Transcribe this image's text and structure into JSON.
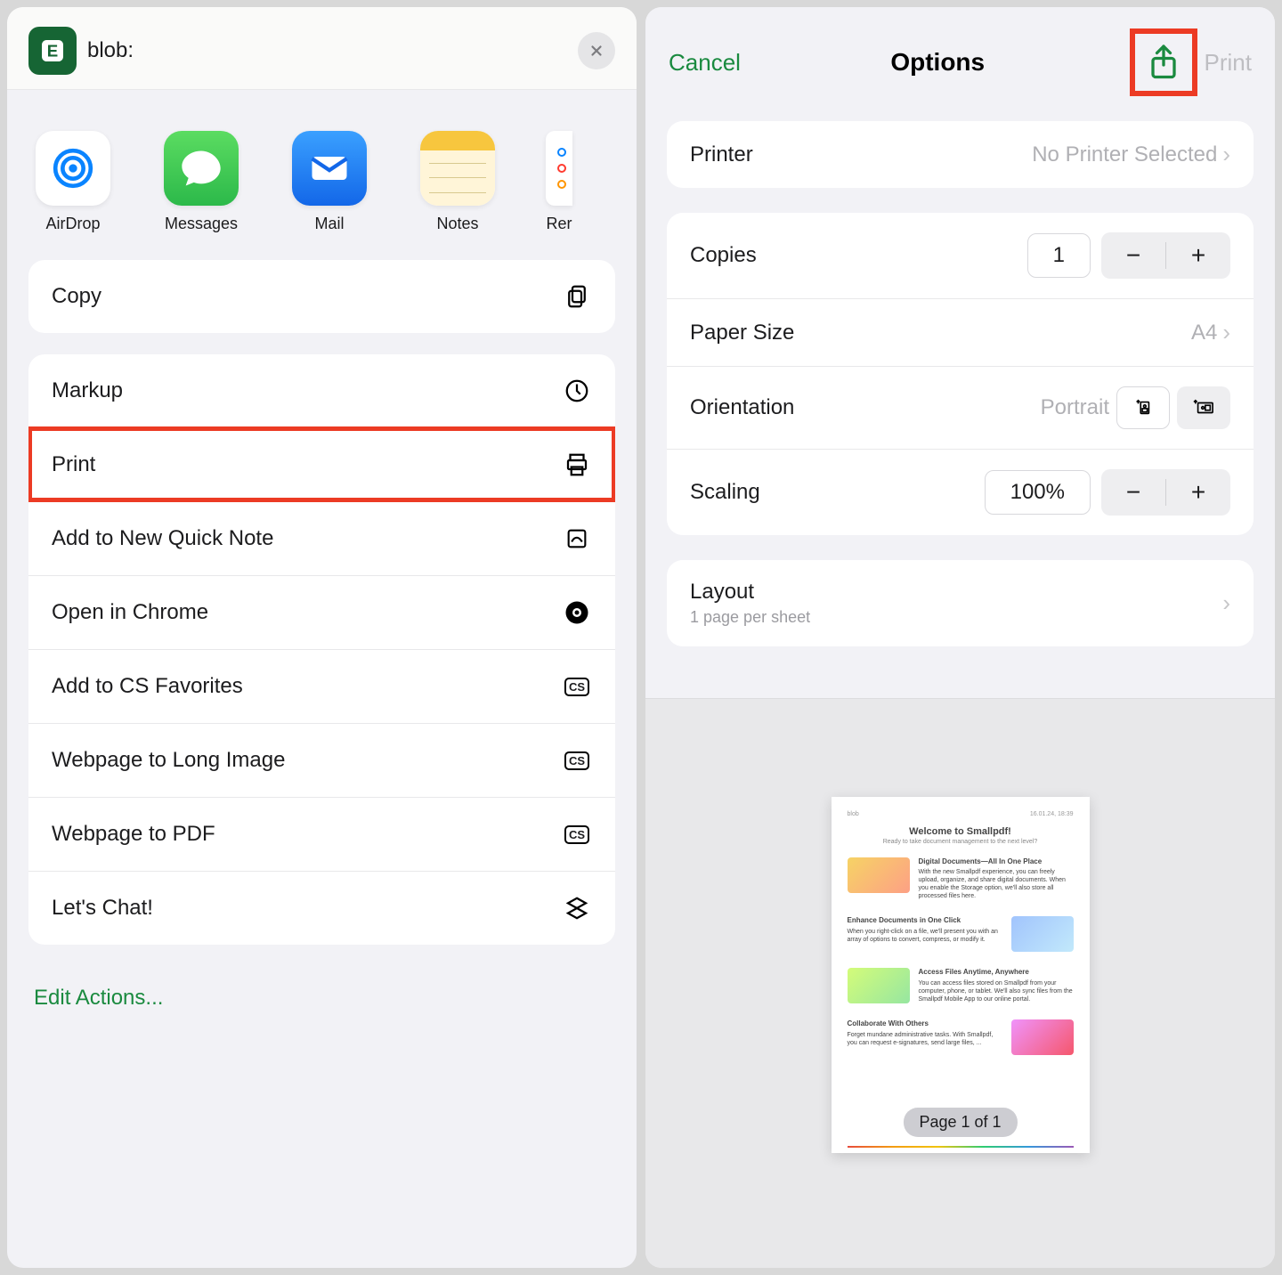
{
  "left": {
    "source_label": "blob:",
    "share_apps": [
      {
        "label": "AirDrop",
        "color": "#ffffff",
        "name": "airdrop"
      },
      {
        "label": "Messages",
        "color": "#34c759",
        "name": "messages"
      },
      {
        "label": "Mail",
        "color": "#1e7cf0",
        "name": "mail"
      },
      {
        "label": "Notes",
        "color": "#ffffff",
        "name": "notes"
      },
      {
        "label": "Rer",
        "color": "#ffffff",
        "name": "reminders-partial"
      }
    ],
    "copy_label": "Copy",
    "actions": [
      {
        "label": "Markup",
        "icon": "markup"
      },
      {
        "label": "Print",
        "icon": "print",
        "highlight": true
      },
      {
        "label": "Add to New Quick Note",
        "icon": "quicknote"
      },
      {
        "label": "Open in Chrome",
        "icon": "chrome"
      },
      {
        "label": "Add to CS Favorites",
        "icon": "cs"
      },
      {
        "label": "Webpage to Long Image",
        "icon": "cs"
      },
      {
        "label": "Webpage to PDF",
        "icon": "cs"
      },
      {
        "label": "Let's Chat!",
        "icon": "chat"
      }
    ],
    "edit_actions_label": "Edit Actions..."
  },
  "right": {
    "cancel_label": "Cancel",
    "title": "Options",
    "print_label": "Print",
    "printer": {
      "label": "Printer",
      "value": "No Printer Selected"
    },
    "copies": {
      "label": "Copies",
      "value": "1"
    },
    "paper": {
      "label": "Paper Size",
      "value": "A4"
    },
    "orientation": {
      "label": "Orientation",
      "value": "Portrait"
    },
    "scaling": {
      "label": "Scaling",
      "value": "100%"
    },
    "layout": {
      "label": "Layout",
      "sub": "1 page per sheet"
    },
    "preview": {
      "page_label": "Page 1 of 1",
      "doc_title": "Welcome to Smallpdf!",
      "doc_sub": "Ready to take document management to the next level?",
      "sections": [
        {
          "h": "Digital Documents—All In One Place",
          "t": "With the new Smallpdf experience, you can freely upload, organize, and share digital documents. When you enable the Storage option, we'll also store all processed files here."
        },
        {
          "h": "Enhance Documents in One Click",
          "t": "When you right-click on a file, we'll present you with an array of options to convert, compress, or modify it."
        },
        {
          "h": "Access Files Anytime, Anywhere",
          "t": "You can access files stored on Smallpdf from your computer, phone, or tablet. We'll also sync files from the Smallpdf Mobile App to our online portal."
        },
        {
          "h": "Collaborate With Others",
          "t": "Forget mundane administrative tasks. With Smallpdf, you can request e-signatures, send large files, ..."
        }
      ]
    }
  }
}
